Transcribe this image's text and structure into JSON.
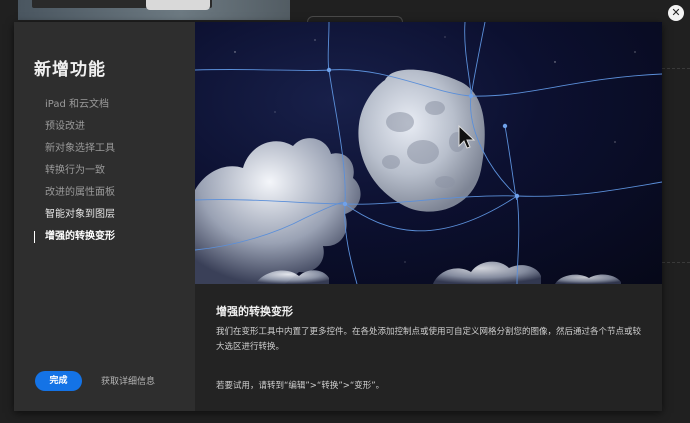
{
  "dialog": {
    "title": "新增功能",
    "nav_items": [
      {
        "label": "iPad 和云文档"
      },
      {
        "label": "预设改进"
      },
      {
        "label": "新对象选择工具"
      },
      {
        "label": "转换行为一致"
      },
      {
        "label": "改进的属性面板"
      },
      {
        "label": "智能对象到图层"
      },
      {
        "label": "增强的转换变形"
      }
    ],
    "active_index": 6,
    "done_label": "完成",
    "details_label": "获取详细信息",
    "close_icon": "close-icon"
  },
  "content": {
    "title": "增强的转换变形",
    "body": "我们在变形工具中内置了更多控件。在各处添加控制点或使用可自定义网格分割您的图像，然后通过各个节点或较大选区进行转换。",
    "tryit": "若要试用，请转到“编辑”>“转换”>“变形”。"
  },
  "colors": {
    "accent": "#1473e6",
    "sidebar_bg": "#2e2e2e",
    "warp_grid": "#5b8fd9"
  }
}
